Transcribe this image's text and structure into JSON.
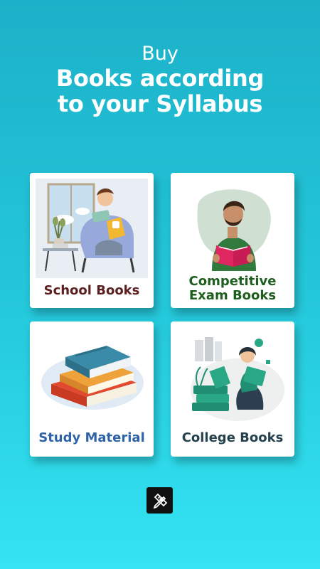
{
  "header": {
    "subtitle": "Buy",
    "title_line1": "Books according",
    "title_line2": "to your Syllabus"
  },
  "categories": [
    {
      "label": "School Books",
      "color": "#5b1f1f",
      "icon": "reading-child-illustration"
    },
    {
      "label_line1": "Competitive",
      "label_line2": "Exam Books",
      "color": "#1e5e1e",
      "icon": "reading-man-illustration"
    },
    {
      "label": "Study Material",
      "color": "#2f63a8",
      "icon": "book-stack-illustration"
    },
    {
      "label": "College Books",
      "color": "#26424f",
      "icon": "reading-student-illustration"
    }
  ],
  "toolbar": {
    "icon": "pencil-ruler-icon"
  }
}
